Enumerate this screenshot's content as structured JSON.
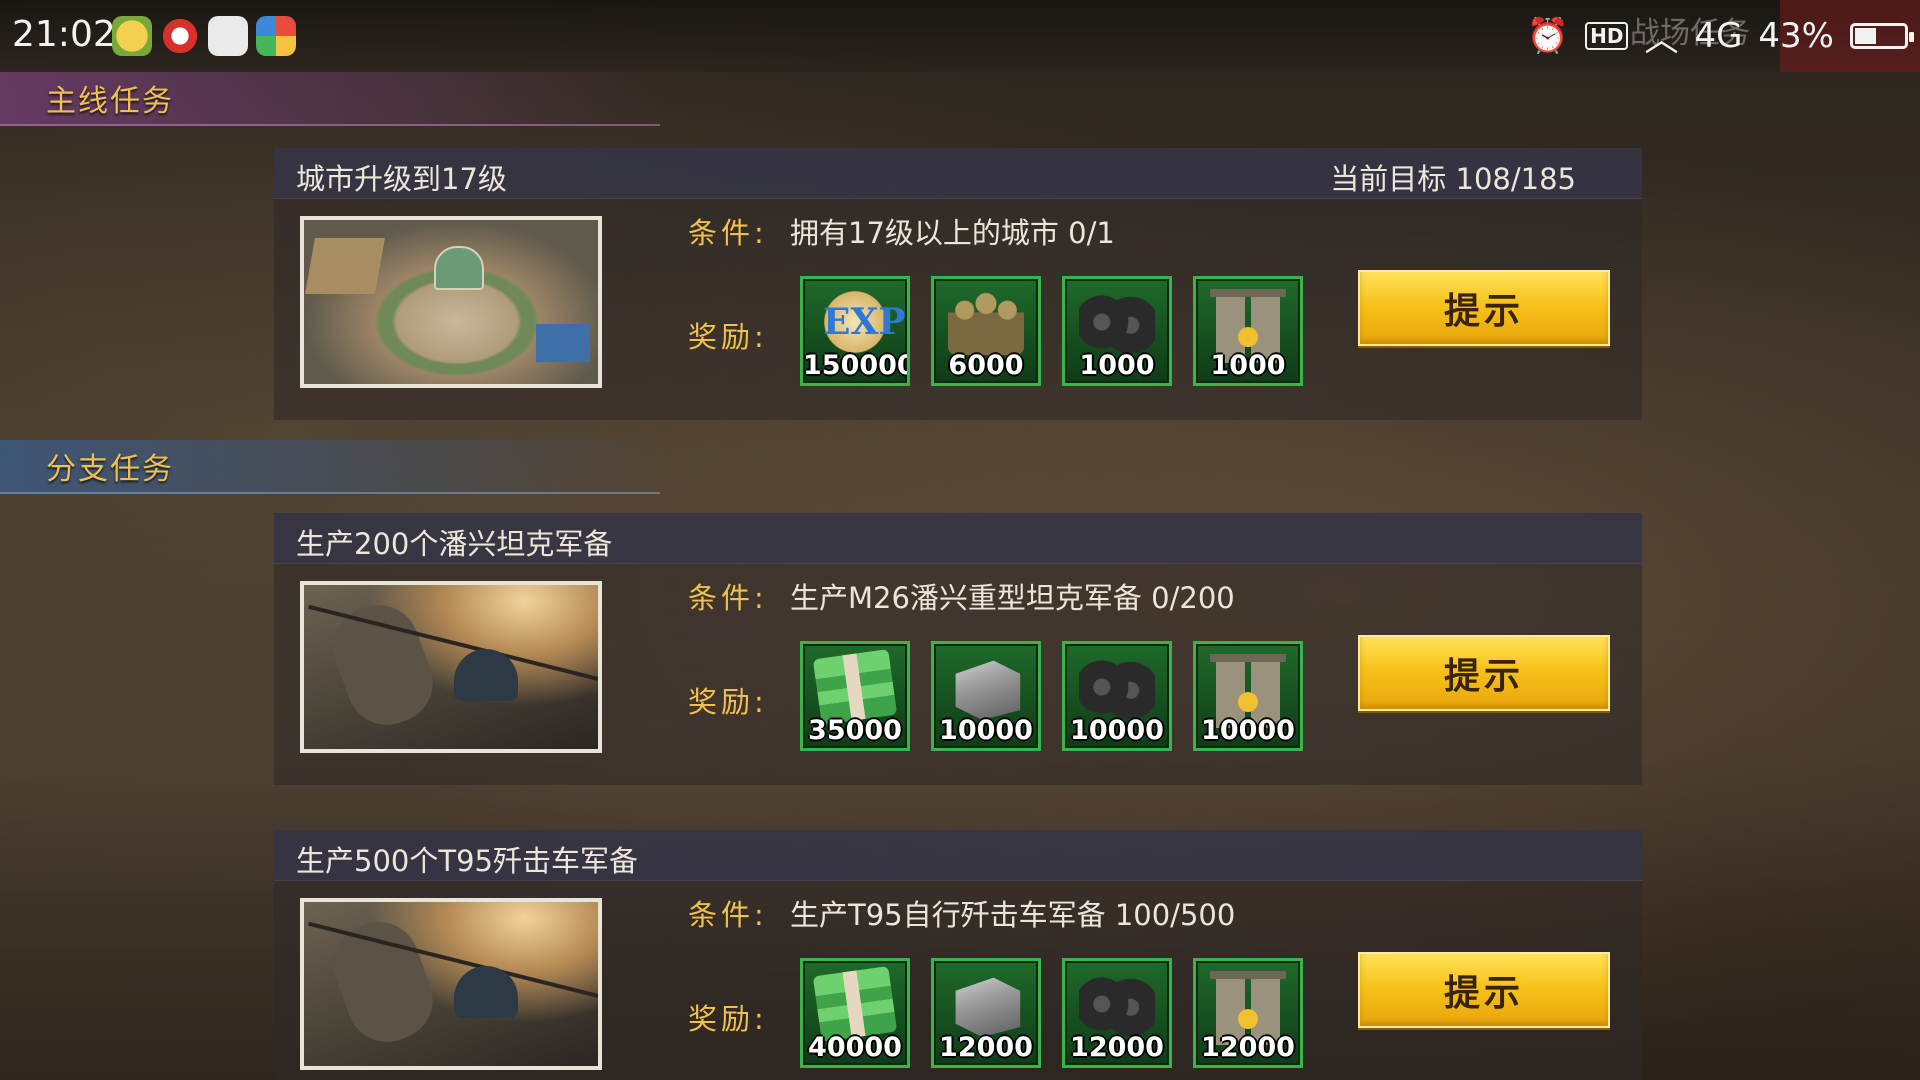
{
  "status_bar": {
    "time": "21:02",
    "alarm_icon": "⏰",
    "hd_label": "HD",
    "watermark": "战场任务",
    "network": "4G",
    "battery": "43%"
  },
  "sections": {
    "main": "主线任务",
    "branch": "分支任务"
  },
  "labels": {
    "condition": "条件:",
    "reward": "奖励:"
  },
  "missions": [
    {
      "title": "城市升级到17级",
      "goal": "当前目标 108/185",
      "condition": "拥有17级以上的城市 0/1",
      "rewards": [
        {
          "icon": "exp-icon",
          "qty": "150000"
        },
        {
          "icon": "troops-icon",
          "qty": "6000"
        },
        {
          "icon": "tire-icon",
          "qty": "1000"
        },
        {
          "icon": "oil-barrel-icon",
          "qty": "1000"
        }
      ],
      "button": "提示"
    },
    {
      "title": "生产200个潘兴坦克军备",
      "condition": "生产M26潘兴重型坦克军备 0/200",
      "rewards": [
        {
          "icon": "cash-icon",
          "qty": "35000"
        },
        {
          "icon": "steel-icon",
          "qty": "10000"
        },
        {
          "icon": "tire-icon",
          "qty": "10000"
        },
        {
          "icon": "oil-barrel-icon",
          "qty": "10000"
        }
      ],
      "button": "提示"
    },
    {
      "title": "生产500个T95歼击车军备",
      "condition": "生产T95自行歼击车军备 100/500",
      "rewards": [
        {
          "icon": "cash-icon",
          "qty": "40000"
        },
        {
          "icon": "steel-icon",
          "qty": "12000"
        },
        {
          "icon": "tire-icon",
          "qty": "12000"
        },
        {
          "icon": "oil-barrel-icon",
          "qty": "12000"
        }
      ],
      "button": "提示"
    }
  ]
}
